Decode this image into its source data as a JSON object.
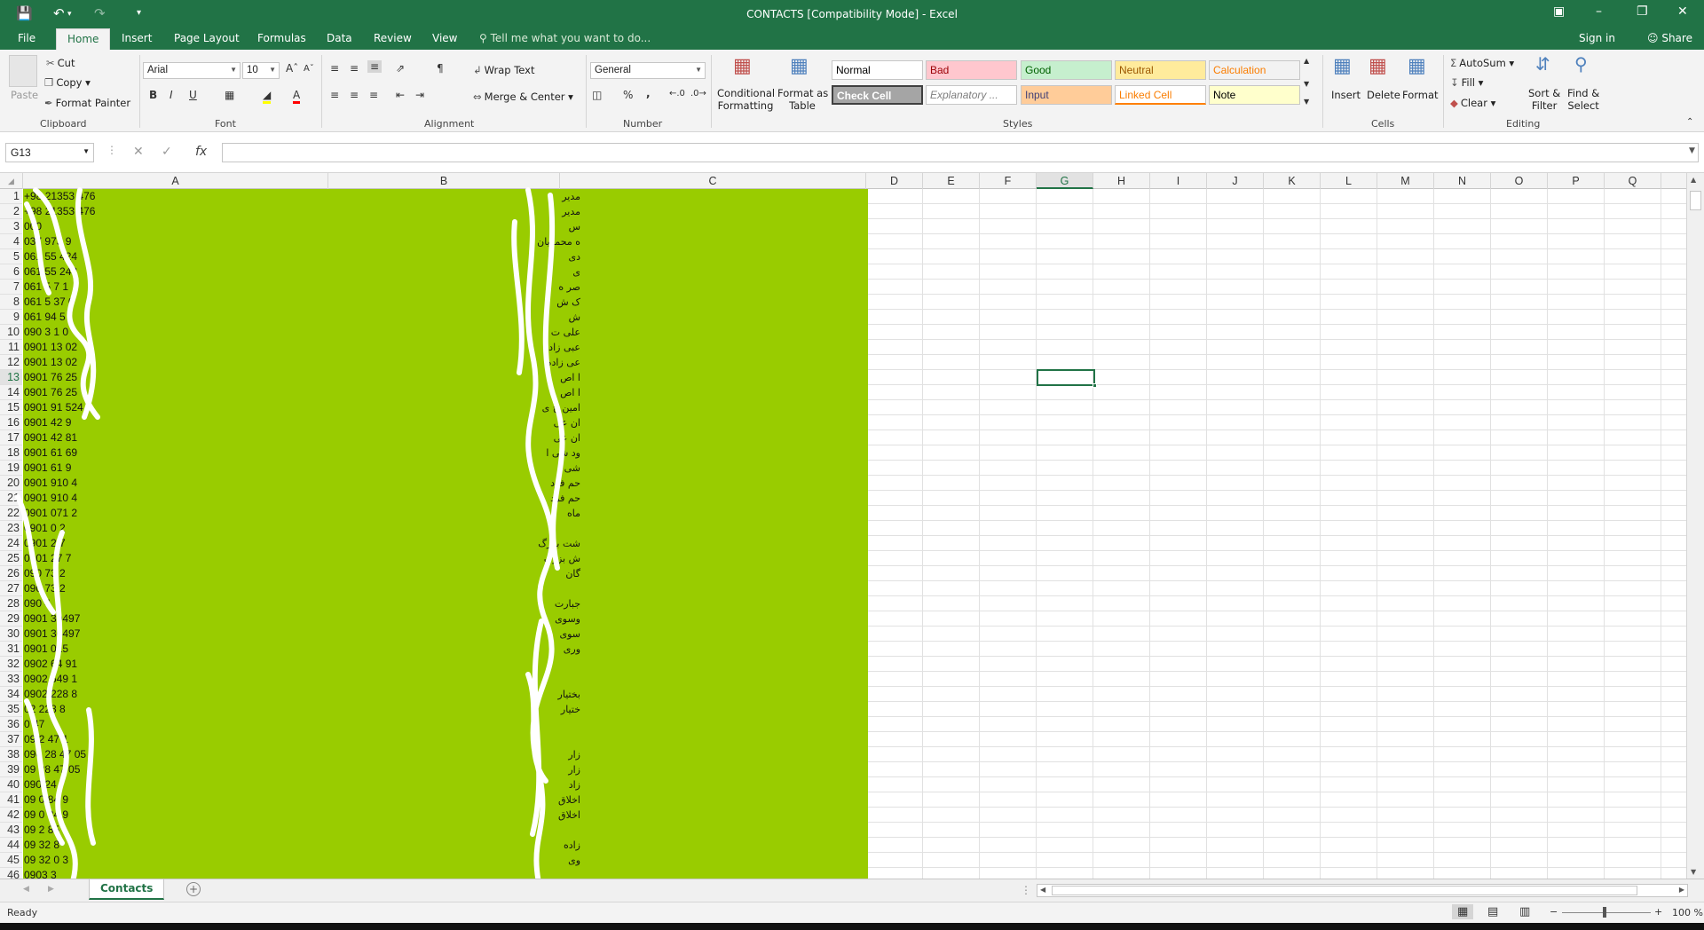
{
  "titlebar": {
    "title": "CONTACTS  [Compatibility Mode] - Excel",
    "save_icon": "save-icon",
    "undo_icon": "undo-icon",
    "redo_icon": "redo-icon",
    "customize_icon": "customize-qat-icon"
  },
  "ribbon_tabs": [
    "File",
    "Home",
    "Insert",
    "Page Layout",
    "Formulas",
    "Data",
    "Review",
    "View"
  ],
  "active_tab": "Home",
  "tell_me": "Tell me what you want to do...",
  "sign_in": "Sign in",
  "share": "Share",
  "clipboard": {
    "paste": "Paste",
    "cut": "Cut",
    "copy": "Copy",
    "format_painter": "Format Painter",
    "label": "Clipboard"
  },
  "font": {
    "name": "Arial",
    "size": "10",
    "bold": "B",
    "italic": "I",
    "underline": "U",
    "label": "Font"
  },
  "alignment": {
    "wrap_text": "Wrap Text",
    "merge_center": "Merge & Center",
    "label": "Alignment"
  },
  "number": {
    "format": "General",
    "percent": "%",
    "comma": ",",
    "label": "Number"
  },
  "styles": {
    "conditional_formatting": [
      "Conditional",
      "Formatting"
    ],
    "format_as_table": [
      "Format as",
      "Table"
    ],
    "label": "Styles",
    "gallery": [
      {
        "label": "Normal",
        "bg": "#ffffff",
        "fg": "#000000"
      },
      {
        "label": "Bad",
        "bg": "#ffc7ce",
        "fg": "#9c0006"
      },
      {
        "label": "Good",
        "bg": "#c6efce",
        "fg": "#006100"
      },
      {
        "label": "Neutral",
        "bg": "#ffeb9c",
        "fg": "#9c5700"
      },
      {
        "label": "Calculation",
        "bg": "#f2f2f2",
        "fg": "#fa7d00"
      },
      {
        "label": "Check Cell",
        "bg": "#a5a5a5",
        "fg": "#ffffff"
      },
      {
        "label": "Explanatory ...",
        "bg": "#ffffff",
        "fg": "#7f7f7f"
      },
      {
        "label": "Input",
        "bg": "#ffcc99",
        "fg": "#3f3f76"
      },
      {
        "label": "Linked Cell",
        "bg": "#ffffff",
        "fg": "#fa7d00"
      },
      {
        "label": "Note",
        "bg": "#ffffcc",
        "fg": "#000000"
      }
    ]
  },
  "cells_group": {
    "insert": "Insert",
    "delete": "Delete",
    "format": "Format",
    "label": "Cells"
  },
  "editing": {
    "autosum": "AutoSum",
    "fill": "Fill",
    "clear": "Clear",
    "sort_filter": [
      "Sort &",
      "Filter"
    ],
    "find_select": [
      "Find &",
      "Select"
    ],
    "label": "Editing"
  },
  "formula_bar": {
    "name_box": "G13",
    "cancel": "✕",
    "enter": "✓",
    "fx": "fx",
    "value": ""
  },
  "columns": [
    "A",
    "B",
    "C",
    "D",
    "E",
    "F",
    "G",
    "H",
    "I",
    "J",
    "K",
    "L",
    "M",
    "N",
    "O",
    "P",
    "Q"
  ],
  "selected_column": "G",
  "selected_row": 13,
  "rows": [
    {
      "n": 1,
      "a": "+98 21353 476",
      "b": "مدیر"
    },
    {
      "n": 2,
      "a": "+98 21353 476",
      "b": "مدیر"
    },
    {
      "n": 3,
      "a": "000",
      "b": "س"
    },
    {
      "n": 4,
      "a": "037 973 9",
      "b": "ه محمدیان"
    },
    {
      "n": 5,
      "a": "061 55 424",
      "b": "دی"
    },
    {
      "n": 6,
      "a": "061 55 243",
      "b": "ی"
    },
    {
      "n": 7,
      "a": "061 5 7 1",
      "b": "صر ه"
    },
    {
      "n": 8,
      "a": "061 5 37 0",
      "b": "ک ش"
    },
    {
      "n": 9,
      "a": "061 94 5",
      "b": "ش"
    },
    {
      "n": 10,
      "a": "090 3 1 0",
      "b": "علی ت"
    },
    {
      "n": 11,
      "a": "0901 13 02",
      "b": "عبی زاده"
    },
    {
      "n": 12,
      "a": "0901 13 02",
      "b": "عی زاده"
    },
    {
      "n": 13,
      "a": "0901 76 25",
      "b": "ا اص"
    },
    {
      "n": 14,
      "a": "0901 76 25",
      "b": "ا اص"
    },
    {
      "n": 15,
      "a": "0901 91 524",
      "b": "امین خ ی"
    },
    {
      "n": 16,
      "a": "0901 42 9",
      "b": "ان عی"
    },
    {
      "n": 17,
      "a": "0901 42 81",
      "b": "ان عی"
    },
    {
      "n": 18,
      "a": "0901 61 69",
      "b": "ود شی ا"
    },
    {
      "n": 19,
      "a": "0901 61 9",
      "b": "شی ا"
    },
    {
      "n": 20,
      "a": "0901 910 4",
      "b": "حم فرد"
    },
    {
      "n": 21,
      "a": "0901 910 4",
      "b": "حم فرد"
    },
    {
      "n": 22,
      "a": "0901 071 2",
      "b": "ماه"
    },
    {
      "n": 23,
      "a": "0901 0 2",
      "b": ""
    },
    {
      "n": 24,
      "a": "0901 2 7",
      "b": "شت بزرگ"
    },
    {
      "n": 25,
      "a": "0901 27 7",
      "b": "ش بزرگ"
    },
    {
      "n": 26,
      "a": "090 73 2",
      "b": "گان"
    },
    {
      "n": 27,
      "a": "090 73 2",
      "b": ""
    },
    {
      "n": 28,
      "a": "090 4",
      "b": "جبارت"
    },
    {
      "n": 29,
      "a": "0901 30497",
      "b": "وسوی"
    },
    {
      "n": 30,
      "a": "0901 30497",
      "b": "سوی"
    },
    {
      "n": 31,
      "a": "0901 015",
      "b": "وری"
    },
    {
      "n": 32,
      "a": "0902 64 91",
      "b": ""
    },
    {
      "n": 33,
      "a": "0902 549 1",
      "b": ""
    },
    {
      "n": 34,
      "a": "0902 228 8",
      "b": "بختیار"
    },
    {
      "n": 35,
      "a": "02 228 8",
      "b": "ختیار"
    },
    {
      "n": 36,
      "a": "0 47",
      "b": ""
    },
    {
      "n": 37,
      "a": "09 2 47 1",
      "b": ""
    },
    {
      "n": 38,
      "a": "090 28 47 05",
      "b": "زار"
    },
    {
      "n": 39,
      "a": "09 28 47 05",
      "b": "زار"
    },
    {
      "n": 40,
      "a": "090 24 7",
      "b": "زاد"
    },
    {
      "n": 41,
      "a": "09 0 84 9",
      "b": "اخلاق"
    },
    {
      "n": 42,
      "a": "09 0 84 9",
      "b": "اخلاق"
    },
    {
      "n": 43,
      "a": "09 2 85",
      "b": ""
    },
    {
      "n": 44,
      "a": "09 32 8",
      "b": "زاده"
    },
    {
      "n": 45,
      "a": "09 32 0 3",
      "b": "وی"
    },
    {
      "n": 46,
      "a": "0903 3",
      "b": ""
    }
  ],
  "sheet_tab": "Contacts",
  "status": {
    "ready": "Ready",
    "zoom": "100 %"
  }
}
